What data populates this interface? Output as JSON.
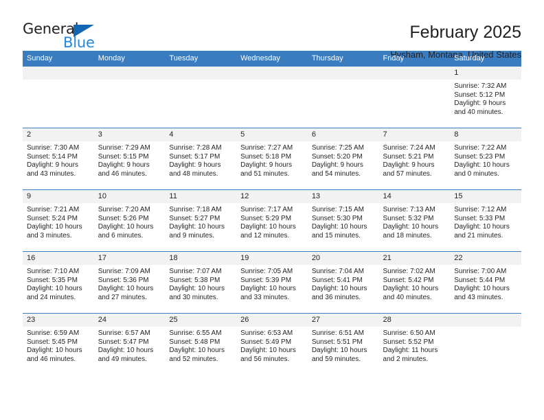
{
  "brand": {
    "name_part1": "General",
    "name_part2": "Blue",
    "accent_color": "#2288dd",
    "triangle_color": "#1565b5"
  },
  "header": {
    "month_title": "February 2025",
    "location": "Hysham, Montana, United States",
    "header_bg_color": "#3A7CC0",
    "date_band_color": "#f2f2f2"
  },
  "weekdays": [
    "Sunday",
    "Monday",
    "Tuesday",
    "Wednesday",
    "Thursday",
    "Friday",
    "Saturday"
  ],
  "weeks": [
    [
      {
        "date": "",
        "sunrise": "",
        "sunset": "",
        "daylight": ""
      },
      {
        "date": "",
        "sunrise": "",
        "sunset": "",
        "daylight": ""
      },
      {
        "date": "",
        "sunrise": "",
        "sunset": "",
        "daylight": ""
      },
      {
        "date": "",
        "sunrise": "",
        "sunset": "",
        "daylight": ""
      },
      {
        "date": "",
        "sunrise": "",
        "sunset": "",
        "daylight": ""
      },
      {
        "date": "",
        "sunrise": "",
        "sunset": "",
        "daylight": ""
      },
      {
        "date": "1",
        "sunrise": "Sunrise: 7:32 AM",
        "sunset": "Sunset: 5:12 PM",
        "daylight": "Daylight: 9 hours and 40 minutes."
      }
    ],
    [
      {
        "date": "2",
        "sunrise": "Sunrise: 7:30 AM",
        "sunset": "Sunset: 5:14 PM",
        "daylight": "Daylight: 9 hours and 43 minutes."
      },
      {
        "date": "3",
        "sunrise": "Sunrise: 7:29 AM",
        "sunset": "Sunset: 5:15 PM",
        "daylight": "Daylight: 9 hours and 46 minutes."
      },
      {
        "date": "4",
        "sunrise": "Sunrise: 7:28 AM",
        "sunset": "Sunset: 5:17 PM",
        "daylight": "Daylight: 9 hours and 48 minutes."
      },
      {
        "date": "5",
        "sunrise": "Sunrise: 7:27 AM",
        "sunset": "Sunset: 5:18 PM",
        "daylight": "Daylight: 9 hours and 51 minutes."
      },
      {
        "date": "6",
        "sunrise": "Sunrise: 7:25 AM",
        "sunset": "Sunset: 5:20 PM",
        "daylight": "Daylight: 9 hours and 54 minutes."
      },
      {
        "date": "7",
        "sunrise": "Sunrise: 7:24 AM",
        "sunset": "Sunset: 5:21 PM",
        "daylight": "Daylight: 9 hours and 57 minutes."
      },
      {
        "date": "8",
        "sunrise": "Sunrise: 7:22 AM",
        "sunset": "Sunset: 5:23 PM",
        "daylight": "Daylight: 10 hours and 0 minutes."
      }
    ],
    [
      {
        "date": "9",
        "sunrise": "Sunrise: 7:21 AM",
        "sunset": "Sunset: 5:24 PM",
        "daylight": "Daylight: 10 hours and 3 minutes."
      },
      {
        "date": "10",
        "sunrise": "Sunrise: 7:20 AM",
        "sunset": "Sunset: 5:26 PM",
        "daylight": "Daylight: 10 hours and 6 minutes."
      },
      {
        "date": "11",
        "sunrise": "Sunrise: 7:18 AM",
        "sunset": "Sunset: 5:27 PM",
        "daylight": "Daylight: 10 hours and 9 minutes."
      },
      {
        "date": "12",
        "sunrise": "Sunrise: 7:17 AM",
        "sunset": "Sunset: 5:29 PM",
        "daylight": "Daylight: 10 hours and 12 minutes."
      },
      {
        "date": "13",
        "sunrise": "Sunrise: 7:15 AM",
        "sunset": "Sunset: 5:30 PM",
        "daylight": "Daylight: 10 hours and 15 minutes."
      },
      {
        "date": "14",
        "sunrise": "Sunrise: 7:13 AM",
        "sunset": "Sunset: 5:32 PM",
        "daylight": "Daylight: 10 hours and 18 minutes."
      },
      {
        "date": "15",
        "sunrise": "Sunrise: 7:12 AM",
        "sunset": "Sunset: 5:33 PM",
        "daylight": "Daylight: 10 hours and 21 minutes."
      }
    ],
    [
      {
        "date": "16",
        "sunrise": "Sunrise: 7:10 AM",
        "sunset": "Sunset: 5:35 PM",
        "daylight": "Daylight: 10 hours and 24 minutes."
      },
      {
        "date": "17",
        "sunrise": "Sunrise: 7:09 AM",
        "sunset": "Sunset: 5:36 PM",
        "daylight": "Daylight: 10 hours and 27 minutes."
      },
      {
        "date": "18",
        "sunrise": "Sunrise: 7:07 AM",
        "sunset": "Sunset: 5:38 PM",
        "daylight": "Daylight: 10 hours and 30 minutes."
      },
      {
        "date": "19",
        "sunrise": "Sunrise: 7:05 AM",
        "sunset": "Sunset: 5:39 PM",
        "daylight": "Daylight: 10 hours and 33 minutes."
      },
      {
        "date": "20",
        "sunrise": "Sunrise: 7:04 AM",
        "sunset": "Sunset: 5:41 PM",
        "daylight": "Daylight: 10 hours and 36 minutes."
      },
      {
        "date": "21",
        "sunrise": "Sunrise: 7:02 AM",
        "sunset": "Sunset: 5:42 PM",
        "daylight": "Daylight: 10 hours and 40 minutes."
      },
      {
        "date": "22",
        "sunrise": "Sunrise: 7:00 AM",
        "sunset": "Sunset: 5:44 PM",
        "daylight": "Daylight: 10 hours and 43 minutes."
      }
    ],
    [
      {
        "date": "23",
        "sunrise": "Sunrise: 6:59 AM",
        "sunset": "Sunset: 5:45 PM",
        "daylight": "Daylight: 10 hours and 46 minutes."
      },
      {
        "date": "24",
        "sunrise": "Sunrise: 6:57 AM",
        "sunset": "Sunset: 5:47 PM",
        "daylight": "Daylight: 10 hours and 49 minutes."
      },
      {
        "date": "25",
        "sunrise": "Sunrise: 6:55 AM",
        "sunset": "Sunset: 5:48 PM",
        "daylight": "Daylight: 10 hours and 52 minutes."
      },
      {
        "date": "26",
        "sunrise": "Sunrise: 6:53 AM",
        "sunset": "Sunset: 5:49 PM",
        "daylight": "Daylight: 10 hours and 56 minutes."
      },
      {
        "date": "27",
        "sunrise": "Sunrise: 6:51 AM",
        "sunset": "Sunset: 5:51 PM",
        "daylight": "Daylight: 10 hours and 59 minutes."
      },
      {
        "date": "28",
        "sunrise": "Sunrise: 6:50 AM",
        "sunset": "Sunset: 5:52 PM",
        "daylight": "Daylight: 11 hours and 2 minutes."
      },
      {
        "date": "",
        "sunrise": "",
        "sunset": "",
        "daylight": ""
      }
    ]
  ]
}
